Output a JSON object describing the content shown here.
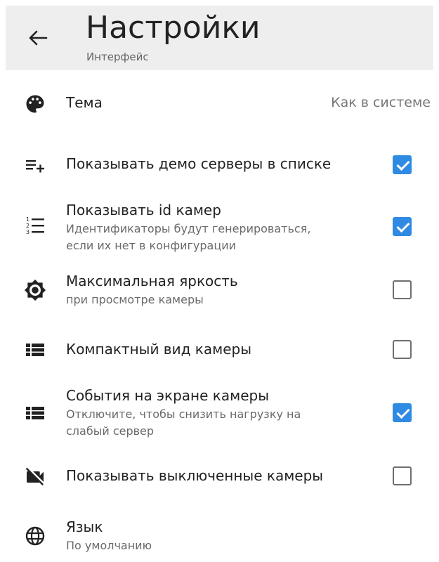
{
  "header": {
    "title": "Настройки",
    "subtitle": "Интерфейс"
  },
  "settings": {
    "theme": {
      "label": "Тема",
      "value": "Как в системе"
    },
    "demo_servers": {
      "label": "Показывать демо серверы в списке",
      "checked": true
    },
    "camera_ids": {
      "label": "Показывать id камер",
      "sub1": "Идентификаторы будут генерироваться,",
      "sub2": "если их нет в конфигурации",
      "checked": true
    },
    "max_brightness": {
      "label": "Максимальная яркость",
      "sub": "при просмотре камеры",
      "checked": false
    },
    "compact_view": {
      "label": "Компактный вид камеры",
      "checked": false
    },
    "events": {
      "label": "События на экране камеры",
      "sub1": "Отключите, чтобы снизить нагрузку на",
      "sub2": "слабый сервер",
      "checked": true
    },
    "disabled_cams": {
      "label": "Показывать выключенные камеры",
      "checked": false
    },
    "language": {
      "label": "Язык",
      "value": "По умолчанию"
    }
  },
  "colors": {
    "accent": "#2f8ae3",
    "appbar": "#eeeeee"
  }
}
